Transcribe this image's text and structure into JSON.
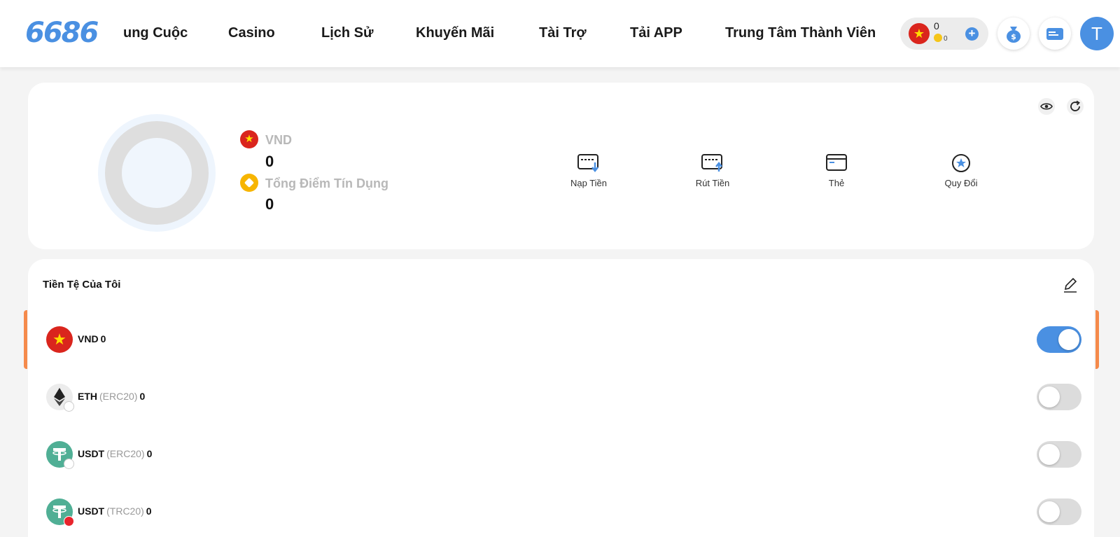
{
  "header": {
    "logo": "6686",
    "nav": [
      {
        "label": "ung Cuộc"
      },
      {
        "label": "Casino"
      },
      {
        "label": "Lịch Sử"
      },
      {
        "label": "Khuyến Mãi"
      },
      {
        "label": "Tài Trợ"
      },
      {
        "label": "Tải APP"
      },
      {
        "label": "Trung Tâm Thành Viên"
      }
    ],
    "balance": {
      "amount": "0",
      "coin_amount": "0",
      "plus": "+"
    },
    "avatar_letter": "T"
  },
  "wallet": {
    "currency_label": "VND",
    "currency_value": "0",
    "credit_label": "Tổng Điểm Tín Dụng",
    "credit_value": "0",
    "actions": [
      {
        "label": "Nạp Tiền",
        "icon": "deposit-card-icon"
      },
      {
        "label": "Rút Tiền",
        "icon": "withdraw-card-icon"
      },
      {
        "label": "Thẻ",
        "icon": "card-icon"
      },
      {
        "label": "Quy Đổi",
        "icon": "exchange-star-icon"
      }
    ]
  },
  "currencies": {
    "title": "Tiền Tệ Của Tôi",
    "items": [
      {
        "code": "VND",
        "network": "",
        "amount": "0",
        "enabled": true
      },
      {
        "code": "ETH",
        "network": "(ERC20)",
        "amount": "0",
        "enabled": false
      },
      {
        "code": "USDT",
        "network": "(ERC20)",
        "amount": "0",
        "enabled": false
      },
      {
        "code": "USDT",
        "network": "(TRC20)",
        "amount": "0",
        "enabled": false
      }
    ]
  },
  "colors": {
    "accent": "#4a90e2",
    "highlight": "#f58a4b",
    "vnd_red": "#da251d",
    "usdt_green": "#50af95",
    "credit_gold": "#f7b500"
  }
}
